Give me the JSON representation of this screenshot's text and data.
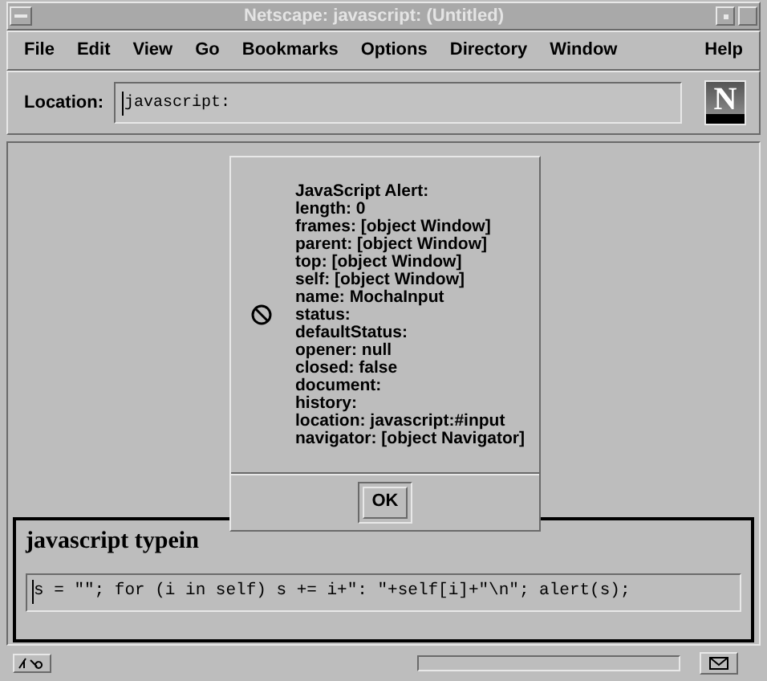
{
  "window": {
    "title": "Netscape: javascript: (Untitled)"
  },
  "menu": [
    {
      "label": "File"
    },
    {
      "label": "Edit"
    },
    {
      "label": "View"
    },
    {
      "label": "Go"
    },
    {
      "label": "Bookmarks"
    },
    {
      "label": "Options"
    },
    {
      "label": "Directory"
    },
    {
      "label": "Window"
    }
  ],
  "help_menu": {
    "label": "Help"
  },
  "location": {
    "label": "Location:",
    "value": "javascript:"
  },
  "logo": {
    "letter": "N"
  },
  "alert": {
    "lines": [
      "JavaScript Alert:",
      "length: 0",
      "frames: [object Window]",
      "parent: [object Window]",
      "top: [object Window]",
      "self: [object Window]",
      "name: MochaInput",
      "status:",
      "defaultStatus:",
      "opener: null",
      "closed: false",
      "document:",
      "history:",
      "location: javascript:#input",
      "navigator: [object Navigator]"
    ],
    "button": "OK"
  },
  "typein": {
    "title": "javascript typein",
    "value": "s = \"\"; for (i in self) s += i+\": \"+self[i]+\"\\n\"; alert(s);"
  }
}
